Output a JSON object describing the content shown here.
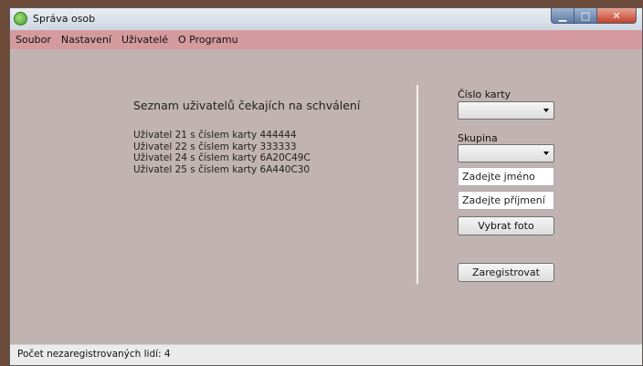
{
  "window": {
    "title": "Správa osob"
  },
  "menu": {
    "items": [
      "Soubor",
      "Nastavení",
      "Uživatelé",
      "O Programu"
    ]
  },
  "main": {
    "heading": "Seznam uživatelů čekajích na schválení",
    "pending": [
      "Uživatel 21 s číslem karty 444444",
      "Uživatel 22 s číslem karty 333333",
      "Uživatel 24 s číslem karty 6A20C49C",
      "Uživatel 25 s číslem karty 6A440C30"
    ]
  },
  "form": {
    "card_label": "Číslo karty",
    "group_label": "Skupina",
    "first_name_placeholder": "Zadejte jméno",
    "last_name_placeholder": "Zadejte příjmení",
    "photo_button": "Vybrat foto",
    "register_button": "Zaregistrovat"
  },
  "status": {
    "text": "Počet nezaregistrovaných lidí: 4"
  },
  "icons": {
    "app": "app-icon",
    "minimize": "minimize-icon",
    "maximize": "maximize-icon",
    "close": "close-icon",
    "dropdown": "chevron-down-icon"
  }
}
